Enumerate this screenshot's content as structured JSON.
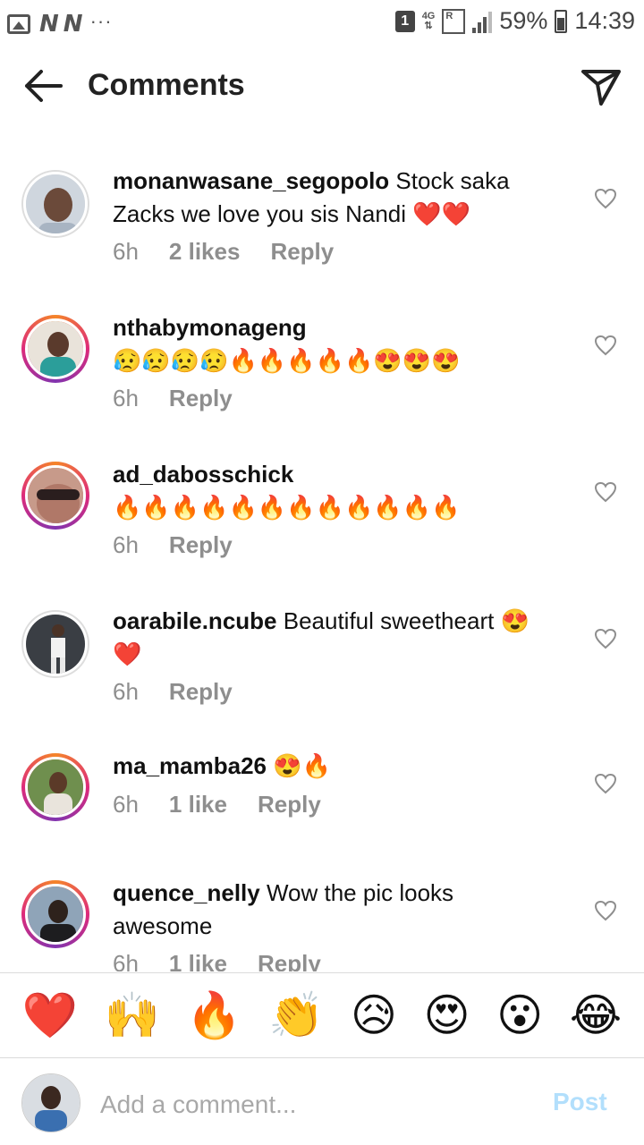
{
  "status_bar": {
    "sim": "1",
    "network": "4G",
    "roaming": "R",
    "battery": "59%",
    "time": "14:39",
    "carrier_icons": "N N",
    "more": "···"
  },
  "header": {
    "title": "Comments",
    "back_icon": "arrow-left-icon",
    "send_icon": "paper-plane-icon"
  },
  "comments": [
    {
      "username": "monanwasane_segopolo",
      "text": "Stock saka Zacks we love you sis Nandi ❤️❤️",
      "time": "6h",
      "likes": "2 likes",
      "reply": "Reply"
    },
    {
      "username": "nthabymonageng",
      "text": "😥😥😥😥🔥🔥🔥🔥🔥😍😍😍",
      "time": "6h",
      "likes": "",
      "reply": "Reply"
    },
    {
      "username": "ad_dabosschick",
      "text": "🔥🔥🔥🔥🔥🔥🔥🔥🔥🔥🔥🔥",
      "time": "6h",
      "likes": "",
      "reply": "Reply"
    },
    {
      "username": "oarabile.ncube",
      "text": "Beautiful sweetheart 😍❤️",
      "time": "6h",
      "likes": "",
      "reply": "Reply"
    },
    {
      "username": "ma_mamba26",
      "text": "😍🔥",
      "time": "6h",
      "likes": "1 like",
      "reply": "Reply"
    },
    {
      "username": "quence_nelly",
      "text": "Wow the pic looks awesome",
      "time": "6h",
      "likes": "1 like",
      "reply": "Reply"
    }
  ],
  "reactions": [
    "❤️",
    "🙌",
    "🔥",
    "👏",
    "😥",
    "😍",
    "😮",
    "😂"
  ],
  "composer": {
    "placeholder": "Add a comment...",
    "post_label": "Post"
  },
  "colors": {
    "muted": "#8e8e8e",
    "post_disabled": "#b2dffc",
    "story_ring": "#dd2a7b"
  }
}
